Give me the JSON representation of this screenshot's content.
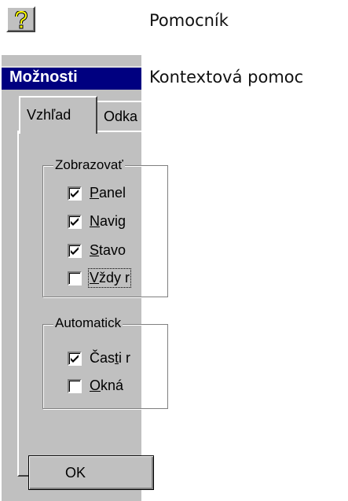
{
  "help_button": {
    "icon": "question-mark-icon",
    "label": "Pomocník"
  },
  "context_help_label": "Kontextová pomoc",
  "dialog": {
    "title": "Možnosti",
    "tabs": [
      {
        "label": "Vzhľad",
        "active": true
      },
      {
        "label": "Odka"
      }
    ],
    "group1": {
      "legend": "Zobrazovať",
      "items": [
        {
          "prefix": "",
          "accel": "P",
          "rest": "anel",
          "checked": true
        },
        {
          "prefix": "",
          "accel": "N",
          "rest": "avig",
          "checked": true
        },
        {
          "prefix": "",
          "accel": "S",
          "rest": "tavo",
          "checked": true
        },
        {
          "prefix": "",
          "accel": "V",
          "rest": "ždy r",
          "checked": false
        }
      ]
    },
    "group2": {
      "legend": "Automatick",
      "items": [
        {
          "prefix": "Čas",
          "accel": "t",
          "rest": "i r",
          "checked": true
        },
        {
          "prefix": "",
          "accel": "O",
          "rest": "kná",
          "checked": false
        }
      ]
    },
    "ok_label": "OK"
  }
}
